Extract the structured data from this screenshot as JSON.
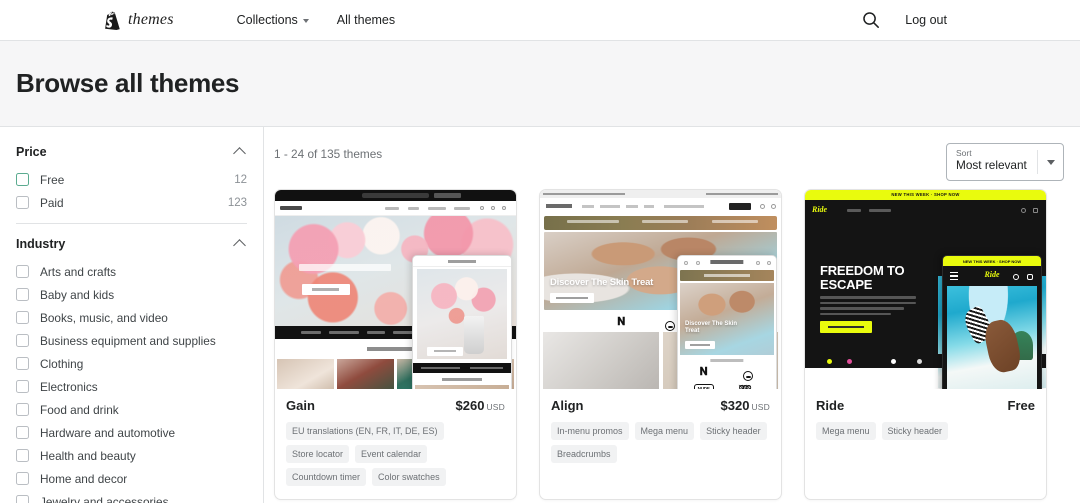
{
  "header": {
    "brand_word": "themes",
    "brand_icon": "shopify-bag-icon",
    "nav": [
      {
        "label": "Collections",
        "has_caret": true
      },
      {
        "label": "All themes",
        "has_caret": false
      }
    ],
    "search_icon": "search-icon",
    "logout_label": "Log out"
  },
  "page": {
    "title": "Browse all themes"
  },
  "sidebar": {
    "facets": [
      {
        "title": "Price",
        "collapse_icon": "chevron-up-icon",
        "options": [
          {
            "label": "Free",
            "count": "12",
            "checked": false,
            "hover": true
          },
          {
            "label": "Paid",
            "count": "123",
            "checked": false,
            "hover": false
          }
        ]
      },
      {
        "title": "Industry",
        "collapse_icon": "chevron-up-icon",
        "options": [
          {
            "label": "Arts and crafts",
            "count": "",
            "checked": false,
            "hover": false
          },
          {
            "label": "Baby and kids",
            "count": "",
            "checked": false,
            "hover": false
          },
          {
            "label": "Books, music, and video",
            "count": "",
            "checked": false,
            "hover": false
          },
          {
            "label": "Business equipment and supplies",
            "count": "",
            "checked": false,
            "hover": false
          },
          {
            "label": "Clothing",
            "count": "",
            "checked": false,
            "hover": false
          },
          {
            "label": "Electronics",
            "count": "",
            "checked": false,
            "hover": false
          },
          {
            "label": "Food and drink",
            "count": "",
            "checked": false,
            "hover": false
          },
          {
            "label": "Hardware and automotive",
            "count": "",
            "checked": false,
            "hover": false
          },
          {
            "label": "Health and beauty",
            "count": "",
            "checked": false,
            "hover": false
          },
          {
            "label": "Home and decor",
            "count": "",
            "checked": false,
            "hover": false
          },
          {
            "label": "Jewelry and accessories",
            "count": "",
            "checked": false,
            "hover": false
          }
        ]
      }
    ]
  },
  "results": {
    "count_text": "1 - 24 of 135 themes",
    "sort": {
      "label": "Sort",
      "value": "Most relevant",
      "caret_icon": "chevron-down-icon"
    },
    "cards": [
      {
        "name": "Gain",
        "price": "$260",
        "currency": "USD",
        "is_free": false,
        "tags": [
          "EU translations (EN, FR, IT, DE, ES)",
          "Store locator",
          "Event calendar",
          "Countdown timer",
          "Color swatches"
        ],
        "preview": {
          "hero_headline": "",
          "style": "floral-light"
        }
      },
      {
        "name": "Align",
        "price": "$320",
        "currency": "USD",
        "is_free": false,
        "tags": [
          "In-menu promos",
          "Mega menu",
          "Sticky header",
          "Breadcrumbs"
        ],
        "preview": {
          "hero_headline": "Discover The Skin Treat",
          "style": "skincare-warm"
        }
      },
      {
        "name": "Ride",
        "price": "Free",
        "currency": "",
        "is_free": true,
        "tags": [
          "Mega menu",
          "Sticky header"
        ],
        "preview": {
          "hero_headline": "FREEDOM TO ESCAPE",
          "announcement": "NEW THIS WEEK  ·  SHOP NOW",
          "style": "surf-dark-yellow"
        }
      }
    ]
  },
  "colors": {
    "accent_green": "#5bab90",
    "ride_yellow": "#e9fb0d",
    "page_band": "#f6f6f7",
    "border": "#e1e3e5",
    "text": "#202223",
    "muted": "#6d7175"
  }
}
